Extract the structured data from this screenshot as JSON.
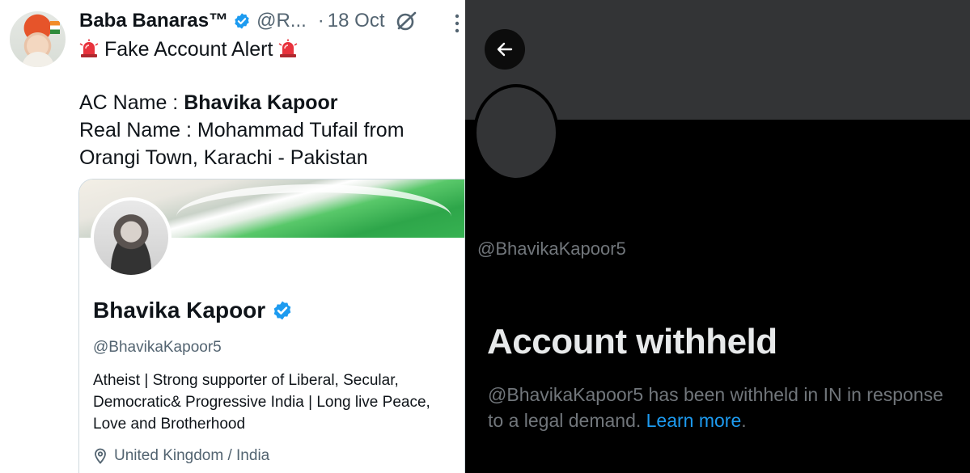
{
  "tweet": {
    "author_name": "Baba Banaras™",
    "author_handle": "@R...",
    "separator": "·",
    "date": "18 Oct",
    "headline": "Fake Account Alert",
    "ac_name_label": "AC Name : ",
    "ac_name_value": "Bhavika Kapoor",
    "real_name_line1": "Real Name : Mohammad Tufail from",
    "real_name_line2": "Orangi Town, Karachi - Pakistan"
  },
  "profile_card": {
    "name": "Bhavika Kapoor",
    "handle": "@BhavikaKapoor5",
    "bio_line1": "Atheist | Strong supporter of Liberal, Secular,",
    "bio_line2": "Democratic& Progressive India | Long live Peace,",
    "bio_line3": "Love and Brotherhood",
    "location": "United Kingdom / India"
  },
  "withheld_view": {
    "handle": "@BhavikaKapoor5",
    "title": "Account withheld",
    "message_line1": "@BhavikaKapoor5 has been withheld in IN in response",
    "message_line2": "to a legal demand. ",
    "link_text": "Learn more",
    "trailing": "."
  },
  "icons": {
    "verified": "verified-badge-icon",
    "grok": "grok-icon",
    "more": "more-options-icon",
    "siren": "siren-emoji-icon",
    "location": "location-pin-icon",
    "back": "back-arrow-icon"
  },
  "colors": {
    "verified_blue": "#1d9bf0",
    "link_blue": "#1d9bf0",
    "dark_bg": "#000000",
    "muted_gray": "#71767b"
  }
}
